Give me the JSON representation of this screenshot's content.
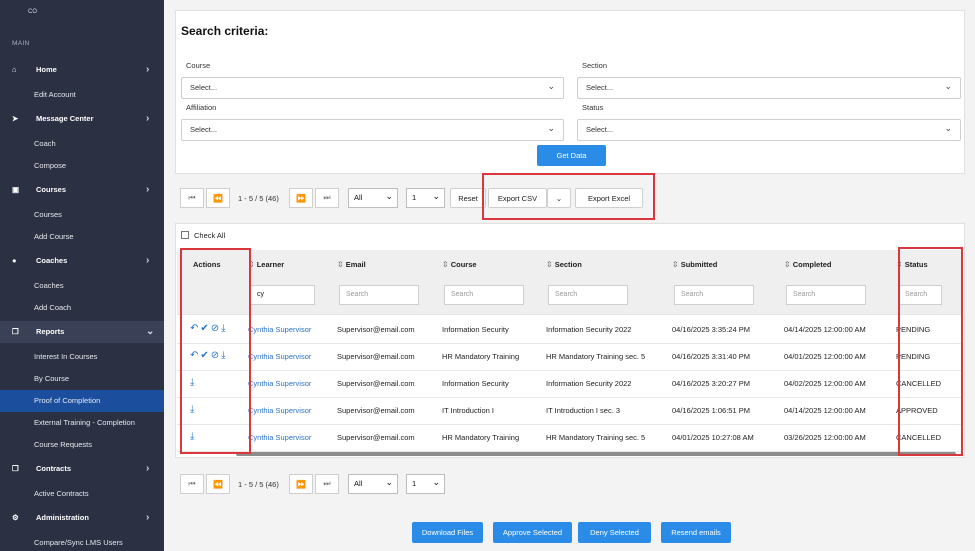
{
  "sidebar": {
    "brand": "CO",
    "main_label": "MAIN",
    "sections": [
      {
        "label": "Home",
        "icon": "home-icon",
        "items": [
          "Edit Account"
        ]
      },
      {
        "label": "Message Center",
        "icon": "send-icon",
        "items": [
          "Coach",
          "Compose"
        ]
      },
      {
        "label": "Courses",
        "icon": "save-icon",
        "items": [
          "Courses",
          "Add Course"
        ]
      },
      {
        "label": "Coaches",
        "icon": "user-icon",
        "items": [
          "Coaches",
          "Add Coach"
        ]
      },
      {
        "label": "Reports",
        "icon": "copy-icon",
        "items": [
          "Interest In Courses",
          "By Course",
          "Proof of Completion",
          "External Training - Completion",
          "Course Requests"
        ]
      },
      {
        "label": "Contracts",
        "icon": "copy-icon",
        "items": [
          "Active Contracts"
        ]
      },
      {
        "label": "Administration",
        "icon": "gear-icon",
        "items": [
          "Compare/Sync LMS Users"
        ]
      }
    ],
    "active_item": "Proof of Completion",
    "expanded_section": "Reports"
  },
  "criteria": {
    "title": "Search criteria:",
    "course_label": "Course",
    "section_label": "Section",
    "affiliation_label": "Affiliation",
    "status_label": "Status",
    "select_placeholder": "Select...",
    "get_data": "Get Data"
  },
  "pager": {
    "info": "1 - 5 / 5 (46)",
    "filter_value": "All",
    "page_value": "1",
    "reset": "Reset",
    "export_csv": "Export CSV",
    "export_excel": "Export Excel"
  },
  "table": {
    "check_all": "Check All",
    "columns": [
      "Actions",
      "Learner",
      "Email",
      "Course",
      "Section",
      "Submitted",
      "Completed",
      "Status"
    ],
    "search_placeholder": "Search",
    "learner_filter": "cy",
    "rows": [
      {
        "actions": "full",
        "learner": "Cynthia Supervisor",
        "email": "Supervisor@email.com",
        "course": "Information Security",
        "section": "Information Security 2022",
        "submitted": "04/16/2025 3:35:24 PM",
        "completed": "04/14/2025 12:00:00 AM",
        "status": "PENDING"
      },
      {
        "actions": "full",
        "learner": "Cynthia Supervisor",
        "email": "Supervisor@email.com",
        "course": "HR Mandatory Training",
        "section": "HR Mandatory Training sec. 5",
        "submitted": "04/16/2025 3:31:40 PM",
        "completed": "04/01/2025 12:00:00 AM",
        "status": "PENDING"
      },
      {
        "actions": "download",
        "learner": "Cynthia Supervisor",
        "email": "Supervisor@email.com",
        "course": "Information Security",
        "section": "Information Security 2022",
        "submitted": "04/16/2025 3:20:27 PM",
        "completed": "04/02/2025 12:00:00 AM",
        "status": "CANCELLED"
      },
      {
        "actions": "download",
        "learner": "Cynthia Supervisor",
        "email": "Supervisor@email.com",
        "course": "IT Introduction I",
        "section": "IT Introduction I sec. 3",
        "submitted": "04/16/2025 1:06:51 PM",
        "completed": "04/14/2025 12:00:00 AM",
        "status": "APPROVED"
      },
      {
        "actions": "download",
        "learner": "Cynthia Supervisor",
        "email": "Supervisor@email.com",
        "course": "HR Mandatory Training",
        "section": "HR Mandatory Training sec. 5",
        "submitted": "04/01/2025 10:27:08 AM",
        "completed": "03/26/2025 12:00:00 AM",
        "status": "CANCELLED"
      }
    ]
  },
  "footer_buttons": [
    "Download Files",
    "Approve Selected",
    "Deny Selected",
    "Resend emails"
  ],
  "colors": {
    "sidebar_bg": "#2b3043",
    "active_bg": "#1b4f9e",
    "accent": "#2a8ce6",
    "highlight_box": "#d9363e",
    "link": "#2a73c7"
  }
}
